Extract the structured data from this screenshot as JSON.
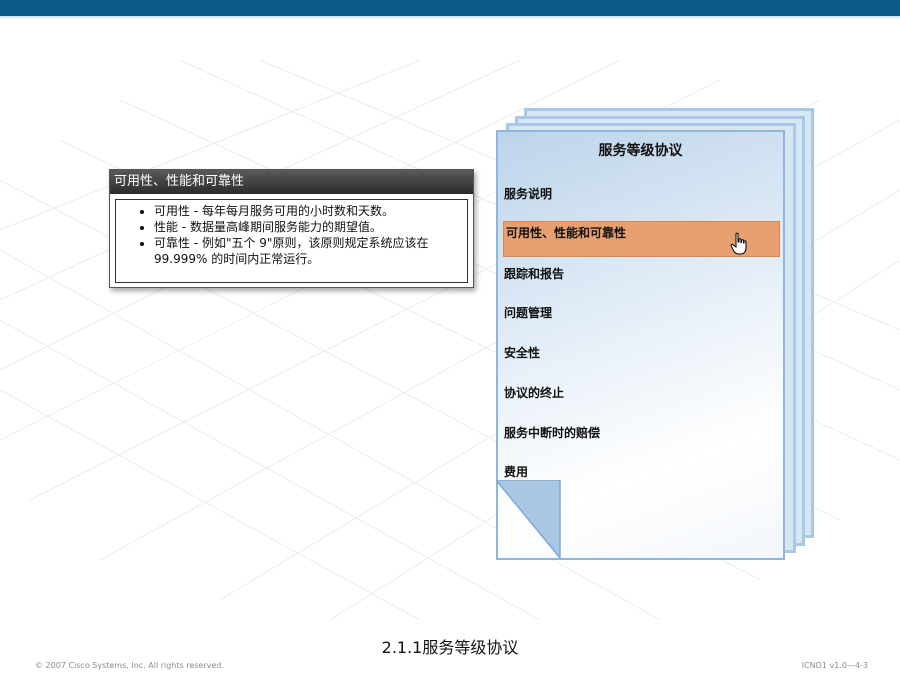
{
  "callout": {
    "title": "可用性、性能和可靠性",
    "bullets": [
      "可用性 - 每年每月服务可用的小时数和天数。",
      "性能 - 数据量高峰期间服务能力的期望值。",
      "可靠性 - 例如\"五个 9\"原则，该原则规定系统应该在 99.999% 的时间内正常运行。"
    ]
  },
  "document": {
    "title": "服务等级协议",
    "items": [
      "服务说明",
      "可用性、性能和可靠性",
      "跟踪和报告",
      "问题管理",
      "安全性",
      "协议的终止",
      "服务中断时的赔偿",
      "费用"
    ],
    "highlighted_index": 1
  },
  "caption": "2.1.1服务等级协议",
  "footer": {
    "copyright": "© 2007 Cisco Systems, Inc. All rights reserved.",
    "page_id": "ICND1 v1.0—4-3"
  },
  "colors": {
    "top_bar": "#0d5a86",
    "highlight": "#e8a070",
    "page_border": "#8fb6dd"
  },
  "icons": [
    "hand-pointer-icon"
  ]
}
